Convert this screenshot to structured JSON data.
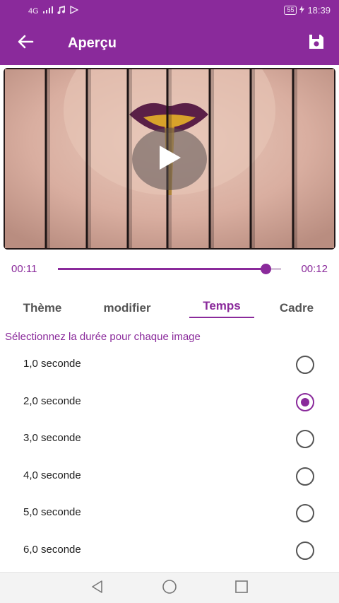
{
  "status_bar": {
    "network": "4G",
    "battery": "55",
    "time": "18:39"
  },
  "app_bar": {
    "title": "Aperçu"
  },
  "preview": {
    "overlay": "play"
  },
  "seek_bar": {
    "current_time": "00:11",
    "total_time": "00:12",
    "progress": 0.93
  },
  "tabs": [
    {
      "label": "Thème",
      "active": false
    },
    {
      "label": "modifier",
      "active": false
    },
    {
      "label": "Temps",
      "active": true
    },
    {
      "label": "Cadre",
      "active": false
    }
  ],
  "duration": {
    "heading": "Sélectionnez la durée pour chaque image",
    "options": [
      {
        "label": "1,0 seconde",
        "selected": false
      },
      {
        "label": "2,0 seconde",
        "selected": true
      },
      {
        "label": "3,0 seconde",
        "selected": false
      },
      {
        "label": "4,0 seconde",
        "selected": false
      },
      {
        "label": "5,0 seconde",
        "selected": false
      },
      {
        "label": "6,0 seconde",
        "selected": false
      }
    ]
  },
  "colors": {
    "primary": "#8a2a9b"
  }
}
